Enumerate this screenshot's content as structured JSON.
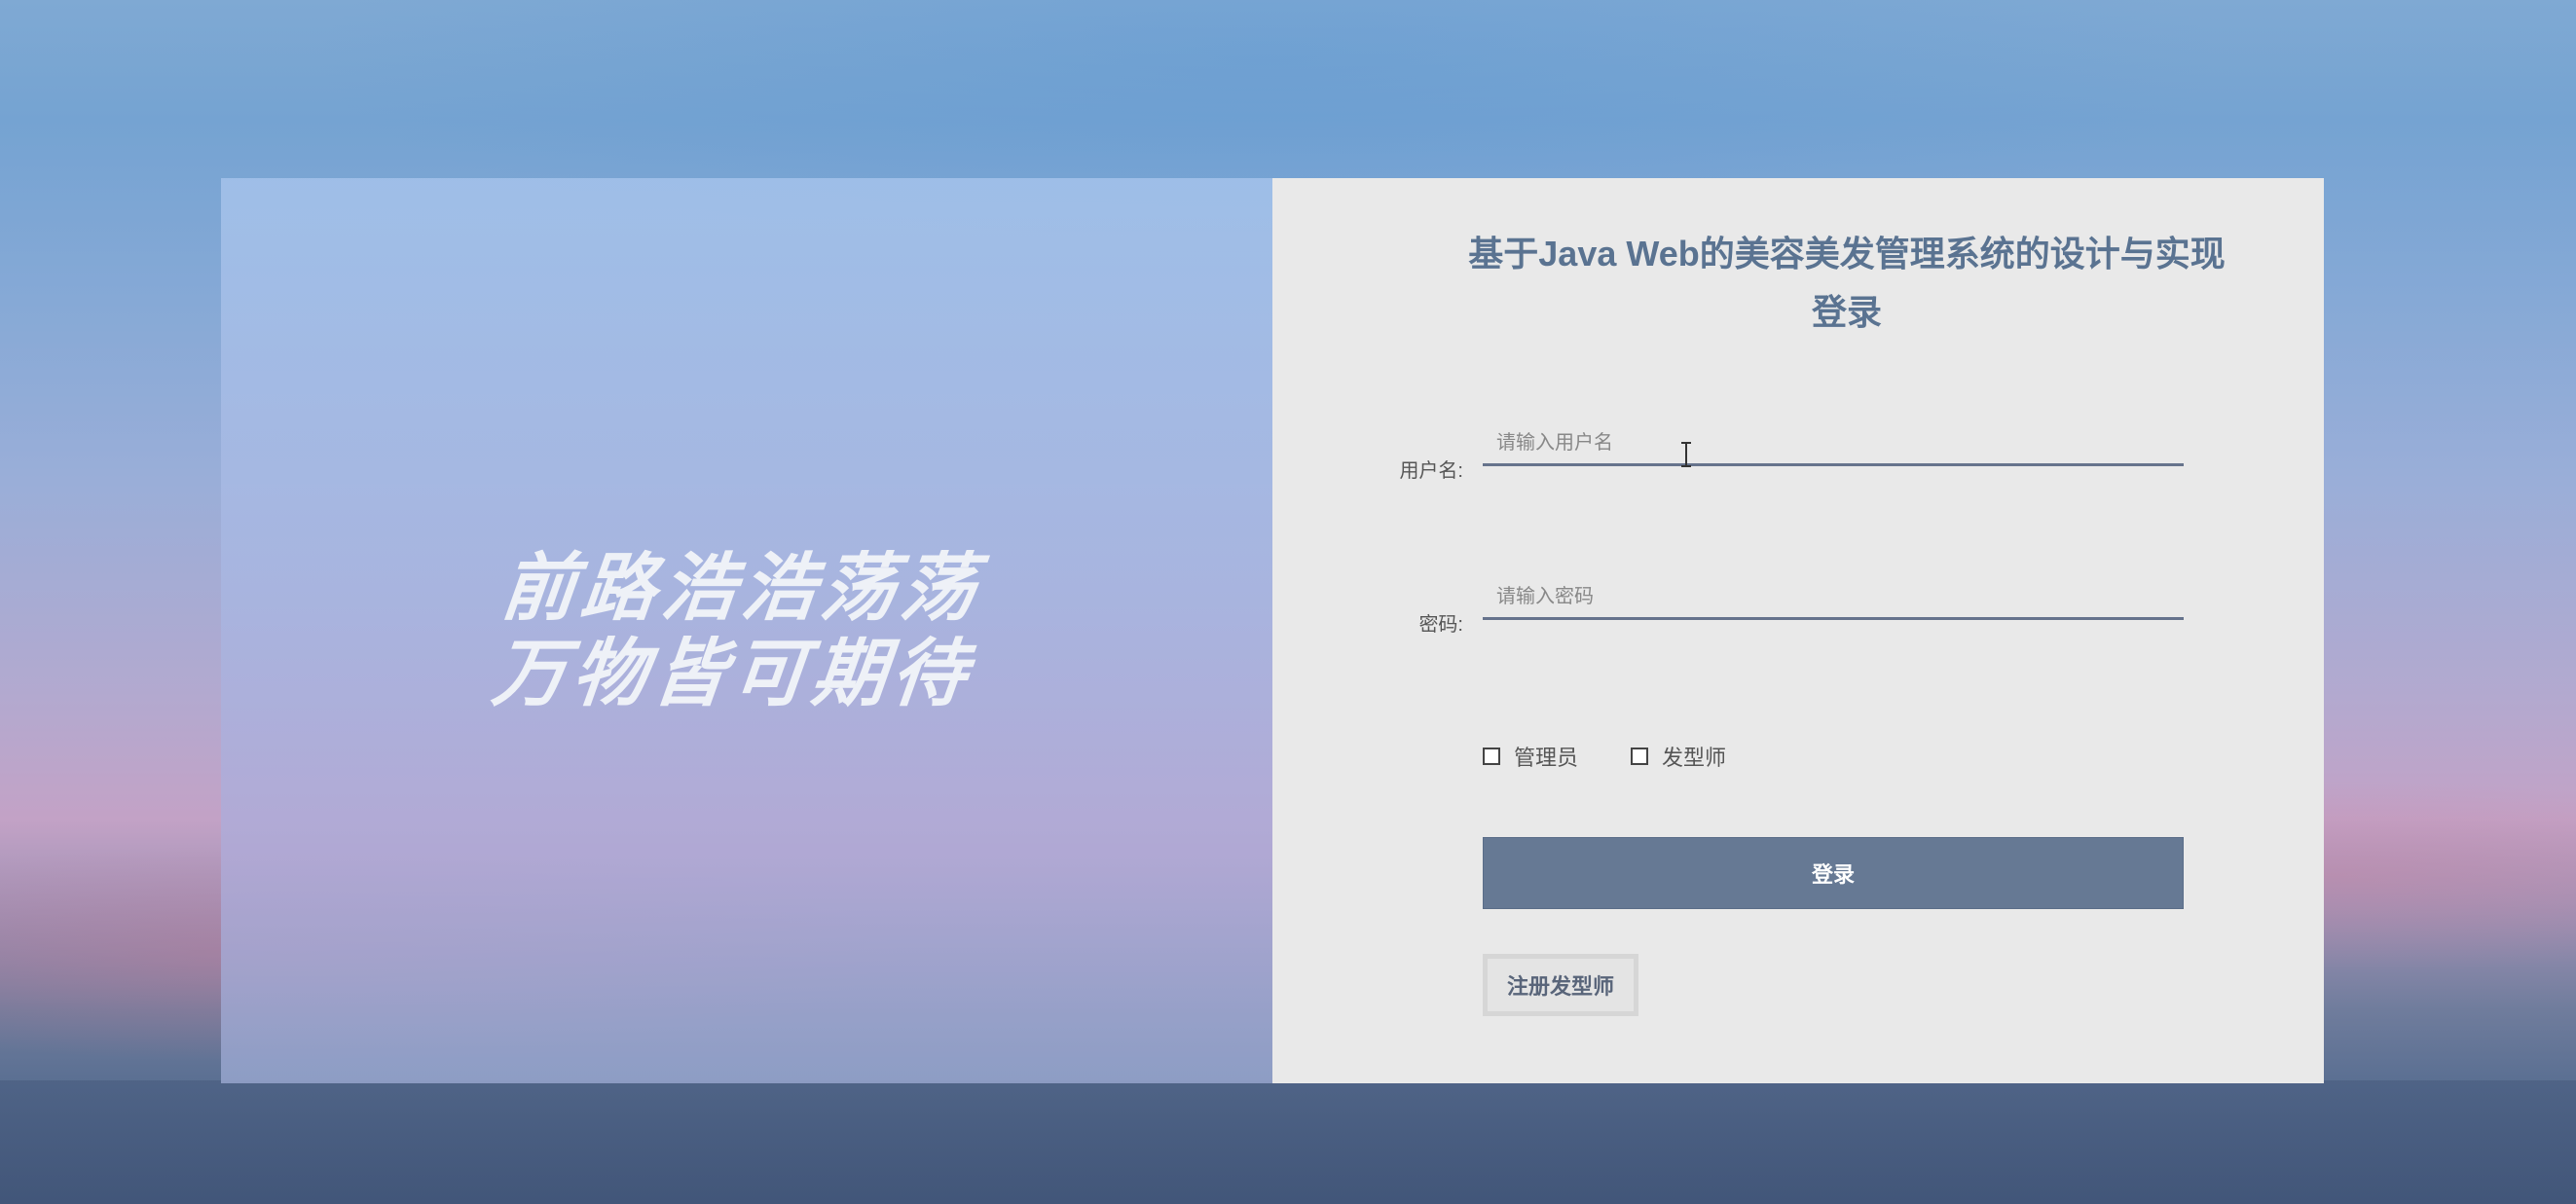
{
  "slogan": {
    "line1": "前路浩浩荡荡",
    "line2": "万物皆可期待"
  },
  "login_form": {
    "title": "基于Java Web的美容美发管理系统的设计与实现登录",
    "username": {
      "label": "用户名:",
      "placeholder": "请输入用户名",
      "value": ""
    },
    "password": {
      "label": "密码:",
      "placeholder": "请输入密码",
      "value": ""
    },
    "roles": [
      {
        "label": "管理员",
        "checked": false
      },
      {
        "label": "发型师",
        "checked": false
      }
    ],
    "login_label": "登录",
    "register_label": "注册发型师"
  },
  "colors": {
    "accent": "#667994",
    "title": "#5a7391",
    "form_background": "#e9e9e9"
  }
}
